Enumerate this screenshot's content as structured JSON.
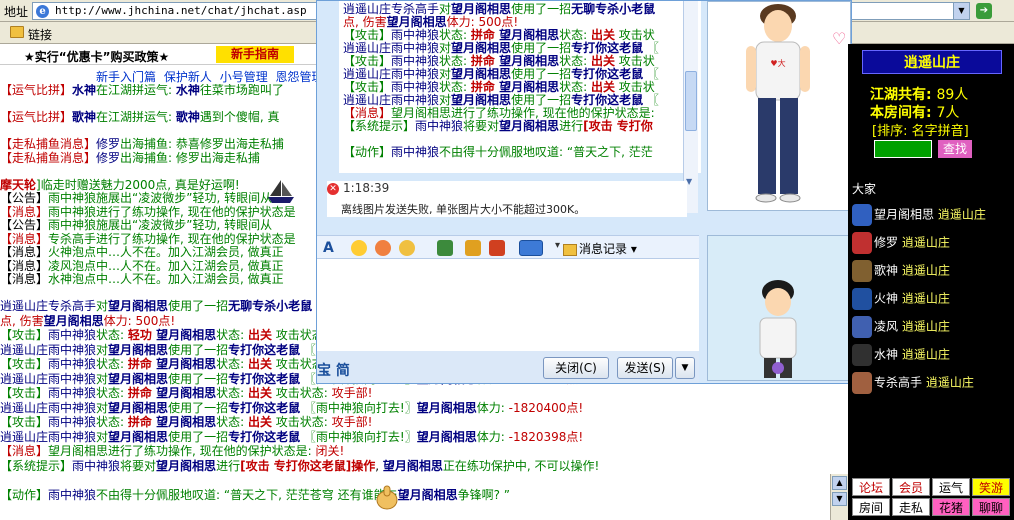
{
  "browser": {
    "address_label": "地址",
    "url": "http://www.jhchina.net/chat/jhchat.asp",
    "links_label": "链接"
  },
  "notice": {
    "text": "★实行“优惠卡”购买政策★",
    "newbie_btn": "新手指南"
  },
  "nav": [
    "新手入门篇",
    "保护新人",
    "小号管理",
    "恩怨管理"
  ],
  "left_lines": [
    [
      {
        "t": "【运气比拼】",
        "c": "r"
      },
      {
        "t": "水神",
        "c": "b bb"
      },
      {
        "t": "在江湖拼运气: ",
        "c": "g"
      },
      {
        "t": "水神",
        "c": "b bb"
      },
      {
        "t": "往菜市场跑叫了",
        "c": "g"
      }
    ],
    [
      {
        "t": "",
        "c": "k"
      }
    ],
    [
      {
        "t": "【运气比拼】",
        "c": "r"
      },
      {
        "t": "歌神",
        "c": "b bb"
      },
      {
        "t": "在江湖拼运气: ",
        "c": "g"
      },
      {
        "t": "歌神",
        "c": "b bb"
      },
      {
        "t": "遇到个傻帽, 真",
        "c": "g"
      }
    ],
    [
      {
        "t": "",
        "c": "k"
      }
    ],
    [
      {
        "t": "【走私捕鱼消息】",
        "c": "r"
      },
      {
        "t": "修罗",
        "c": "b"
      },
      {
        "t": "出海捕鱼: 恭喜修罗出海走私捕",
        "c": "g"
      }
    ],
    [
      {
        "t": "【走私捕鱼消息】",
        "c": "r"
      },
      {
        "t": "修罗",
        "c": "b"
      },
      {
        "t": "出海捕鱼: 修罗出海走私捕",
        "c": "g"
      }
    ],
    [
      {
        "t": "",
        "c": "k"
      }
    ],
    [
      {
        "t": "摩天轮",
        "c": "r bb"
      },
      {
        "t": "]临走时赠送魅力2000点, 真是好运啊!",
        "c": "g"
      }
    ],
    [
      {
        "t": "【公告】",
        "c": "k"
      },
      {
        "t": "雨中神狼施展出“凌波微步”轻功, 转眼间从",
        "c": "g"
      }
    ],
    [
      {
        "t": "【消息】",
        "c": "r"
      },
      {
        "t": "雨中神狼进行了练功操作, 现在他的保护状态是",
        "c": "g"
      }
    ],
    [
      {
        "t": "【公告】",
        "c": "k"
      },
      {
        "t": "雨中神狼施展出“凌波微步”轻功, 转眼间从",
        "c": "g"
      }
    ],
    [
      {
        "t": "【消息】",
        "c": "r"
      },
      {
        "t": "专杀高手进行了练功操作, 现在他的保护状态是",
        "c": "g"
      }
    ],
    [
      {
        "t": "【消息】",
        "c": "k"
      },
      {
        "t": "火神泡点中…人不在。加入江湖会员, 做真正",
        "c": "g"
      }
    ],
    [
      {
        "t": "【消息】",
        "c": "k"
      },
      {
        "t": "凌风泡点中…人不在。加入江湖会员, 做真正",
        "c": "g"
      }
    ],
    [
      {
        "t": "【消息】",
        "c": "k"
      },
      {
        "t": "水神泡点中…人不在。加入江湖会员, 做真正",
        "c": "g"
      }
    ]
  ],
  "lower_lines": [
    [
      {
        "t": "逍遥山庄",
        "c": "b"
      },
      {
        "t": "专杀高手",
        "c": "b"
      },
      {
        "t": "对",
        "c": "g"
      },
      {
        "t": "望月阁相思",
        "c": "b bb"
      },
      {
        "t": "使用了一招",
        "c": "g"
      },
      {
        "t": "无聊专杀小老鼠",
        "c": "b bb"
      }
    ],
    [
      {
        "t": "点, 伤害",
        "c": "r"
      },
      {
        "t": "望月阁相思",
        "c": "b bb"
      },
      {
        "t": "体力: ",
        "c": "r"
      },
      {
        "t": "500点!",
        "c": "r"
      }
    ],
    [
      {
        "t": "【攻击】",
        "c": "g"
      },
      {
        "t": "雨中神狼",
        "c": "b"
      },
      {
        "t": "状态: ",
        "c": "g"
      },
      {
        "t": "轻功",
        "c": "r bb"
      },
      {
        "t": "  望月阁相思",
        "c": "b bb"
      },
      {
        "t": "状态: ",
        "c": "g"
      },
      {
        "t": "出关",
        "c": "r bb"
      },
      {
        "t": "  攻击状态: ",
        "c": "g"
      },
      {
        "t": "攻手部!",
        "c": "r"
      }
    ],
    [
      {
        "t": "逍遥山庄",
        "c": "b"
      },
      {
        "t": "雨中神狼",
        "c": "b"
      },
      {
        "t": "对",
        "c": "g"
      },
      {
        "t": "望月阁相思",
        "c": "b bb"
      },
      {
        "t": "使用了一招",
        "c": "g"
      },
      {
        "t": "专打你这老鼠",
        "c": "b bb"
      },
      {
        "t": "  〖雨中神狼向打去!〗",
        "c": "g"
      },
      {
        "t": "望月阁相思",
        "c": "b bb"
      },
      {
        "t": "体力: ",
        "c": "g"
      },
      {
        "t": "-1820400点!",
        "c": "r"
      }
    ],
    [
      {
        "t": "【攻击】",
        "c": "g"
      },
      {
        "t": "雨中神狼",
        "c": "b"
      },
      {
        "t": "状态: ",
        "c": "g"
      },
      {
        "t": "拼命",
        "c": "r bb"
      },
      {
        "t": "  望月阁相思",
        "c": "b bb"
      },
      {
        "t": "状态: ",
        "c": "g"
      },
      {
        "t": "出关",
        "c": "r bb"
      },
      {
        "t": "  攻击状态: ",
        "c": "g"
      },
      {
        "t": "攻手部!",
        "c": "r"
      }
    ],
    [
      {
        "t": "逍遥山庄",
        "c": "b"
      },
      {
        "t": "雨中神狼",
        "c": "b"
      },
      {
        "t": "对",
        "c": "g"
      },
      {
        "t": "望月阁相思",
        "c": "b bb"
      },
      {
        "t": "使用了一招",
        "c": "g"
      },
      {
        "t": "专打你这老鼠",
        "c": "b bb"
      },
      {
        "t": "  〖雨中神狼向打去!〗",
        "c": "g"
      },
      {
        "t": "望月阁相思",
        "c": "b bb"
      },
      {
        "t": "体力: ",
        "c": "g"
      },
      {
        "t": "-1820400点!",
        "c": "r"
      }
    ],
    [
      {
        "t": "【攻击】",
        "c": "g"
      },
      {
        "t": "雨中神狼",
        "c": "b"
      },
      {
        "t": "状态: ",
        "c": "g"
      },
      {
        "t": "拼命",
        "c": "r bb"
      },
      {
        "t": "  望月阁相思",
        "c": "b bb"
      },
      {
        "t": "状态: ",
        "c": "g"
      },
      {
        "t": "出关",
        "c": "r bb"
      },
      {
        "t": "  攻击状态: ",
        "c": "g"
      },
      {
        "t": "攻手部!",
        "c": "r"
      }
    ],
    [
      {
        "t": "逍遥山庄",
        "c": "b"
      },
      {
        "t": "雨中神狼",
        "c": "b"
      },
      {
        "t": "对",
        "c": "g"
      },
      {
        "t": "望月阁相思",
        "c": "b bb"
      },
      {
        "t": "使用了一招",
        "c": "g"
      },
      {
        "t": "专打你这老鼠",
        "c": "b bb"
      },
      {
        "t": "  〖雨中神狼向打去!〗",
        "c": "g"
      },
      {
        "t": "望月阁相思",
        "c": "b bb"
      },
      {
        "t": "体力: ",
        "c": "g"
      },
      {
        "t": "-1820400点!",
        "c": "r"
      }
    ],
    [
      {
        "t": "【攻击】",
        "c": "g"
      },
      {
        "t": "雨中神狼",
        "c": "b"
      },
      {
        "t": "状态: ",
        "c": "g"
      },
      {
        "t": "拼命",
        "c": "r bb"
      },
      {
        "t": "  望月阁相思",
        "c": "b bb"
      },
      {
        "t": "状态: ",
        "c": "g"
      },
      {
        "t": "出关",
        "c": "r bb"
      },
      {
        "t": "  攻击状态: ",
        "c": "g"
      },
      {
        "t": "攻手部!",
        "c": "r"
      }
    ],
    [
      {
        "t": "逍遥山庄",
        "c": "b"
      },
      {
        "t": "雨中神狼",
        "c": "b"
      },
      {
        "t": "对",
        "c": "g"
      },
      {
        "t": "望月阁相思",
        "c": "b bb"
      },
      {
        "t": "使用了一招",
        "c": "g"
      },
      {
        "t": "专打你这老鼠",
        "c": "b bb"
      },
      {
        "t": "  〖雨中神狼向打去!〗",
        "c": "g"
      },
      {
        "t": "望月阁相思",
        "c": "b bb"
      },
      {
        "t": "体力: ",
        "c": "g"
      },
      {
        "t": "-1820398点!",
        "c": "r"
      }
    ],
    [
      {
        "t": "【消息】",
        "c": "r"
      },
      {
        "t": "望月阁相思进行了练功操作, 现在他的保护状态是: ",
        "c": "g"
      },
      {
        "t": "闭关!",
        "c": "r"
      }
    ],
    [
      {
        "t": "【系统提示】",
        "c": "g"
      },
      {
        "t": "雨中神狼",
        "c": "b"
      },
      {
        "t": "将要对",
        "c": "g"
      },
      {
        "t": "望月阁相思",
        "c": "b bb"
      },
      {
        "t": "进行",
        "c": "g"
      },
      {
        "t": "[攻击  专打你这老鼠]操作",
        "c": "r bb"
      },
      {
        "t": ", ",
        "c": "k"
      },
      {
        "t": "望月阁相思",
        "c": "b bb"
      },
      {
        "t": "正在练功保护中, 不可以操作!",
        "c": "g"
      }
    ],
    [
      {
        "t": "",
        "c": "k"
      }
    ],
    [
      {
        "t": "【动作】",
        "c": "g"
      },
      {
        "t": "雨中神狼",
        "c": "b"
      },
      {
        "t": "不由得十分佩服地叹道: “普天之下, 茫茫苍穹",
        "c": "g"
      },
      {
        "t": "     还有谁能与",
        "c": "g"
      },
      {
        "t": "望月阁相思",
        "c": "b bb"
      },
      {
        "t": "争锋啊? ”",
        "c": "g"
      }
    ]
  ],
  "qq_history": [
    [
      {
        "t": "逍遥山庄",
        "c": "b"
      },
      {
        "t": "专杀高手",
        "c": "b"
      },
      {
        "t": "对",
        "c": "g"
      },
      {
        "t": "望月阁相思",
        "c": "b bb"
      },
      {
        "t": "使用了一招",
        "c": "g"
      },
      {
        "t": "无聊专杀小老鼠",
        "c": "b bb"
      }
    ],
    [
      {
        "t": "点, 伤害",
        "c": "r"
      },
      {
        "t": "望月阁相思",
        "c": "b bb"
      },
      {
        "t": "体力: ",
        "c": "r"
      },
      {
        "t": "500点!",
        "c": "r"
      }
    ],
    [
      {
        "t": "【攻击】",
        "c": "g"
      },
      {
        "t": "雨中神狼",
        "c": "b"
      },
      {
        "t": "状态: ",
        "c": "g"
      },
      {
        "t": "拼命",
        "c": "r bb"
      },
      {
        "t": "  望月阁相思",
        "c": "b bb"
      },
      {
        "t": "状态: ",
        "c": "g"
      },
      {
        "t": "出关",
        "c": "r bb"
      },
      {
        "t": "  攻击状",
        "c": "g"
      }
    ],
    [
      {
        "t": "逍遥山庄",
        "c": "b"
      },
      {
        "t": "雨中神狼",
        "c": "b"
      },
      {
        "t": "对",
        "c": "g"
      },
      {
        "t": "望月阁相思",
        "c": "b bb"
      },
      {
        "t": "使用了一招",
        "c": "g"
      },
      {
        "t": "专打你这老鼠",
        "c": "b bb"
      },
      {
        "t": "  〖",
        "c": "g"
      }
    ],
    [
      {
        "t": "【攻击】",
        "c": "g"
      },
      {
        "t": "雨中神狼",
        "c": "b"
      },
      {
        "t": "状态: ",
        "c": "g"
      },
      {
        "t": "拼命",
        "c": "r bb"
      },
      {
        "t": "  望月阁相思",
        "c": "b bb"
      },
      {
        "t": "状态: ",
        "c": "g"
      },
      {
        "t": "出关",
        "c": "r bb"
      },
      {
        "t": "  攻击状",
        "c": "g"
      }
    ],
    [
      {
        "t": "逍遥山庄",
        "c": "b"
      },
      {
        "t": "雨中神狼",
        "c": "b"
      },
      {
        "t": "对",
        "c": "g"
      },
      {
        "t": "望月阁相思",
        "c": "b bb"
      },
      {
        "t": "使用了一招",
        "c": "g"
      },
      {
        "t": "专打你这老鼠",
        "c": "b bb"
      },
      {
        "t": "  〖",
        "c": "g"
      }
    ],
    [
      {
        "t": "【攻击】",
        "c": "g"
      },
      {
        "t": "雨中神狼",
        "c": "b"
      },
      {
        "t": "状态: ",
        "c": "g"
      },
      {
        "t": "拼命",
        "c": "r bb"
      },
      {
        "t": "  望月阁相思",
        "c": "b bb"
      },
      {
        "t": "状态: ",
        "c": "g"
      },
      {
        "t": "出关",
        "c": "r bb"
      },
      {
        "t": "  攻击状",
        "c": "g"
      }
    ],
    [
      {
        "t": "逍遥山庄",
        "c": "b"
      },
      {
        "t": "雨中神狼",
        "c": "b"
      },
      {
        "t": "对",
        "c": "g"
      },
      {
        "t": "望月阁相思",
        "c": "b bb"
      },
      {
        "t": "使用了一招",
        "c": "g"
      },
      {
        "t": "专打你这老鼠",
        "c": "b bb"
      },
      {
        "t": "  〖",
        "c": "g"
      }
    ],
    [
      {
        "t": "【消息】",
        "c": "r"
      },
      {
        "t": "望月阁相思进行了练功操作, 现在他的保护状态是: ",
        "c": "g"
      }
    ],
    [
      {
        "t": "【系统提示】",
        "c": "g"
      },
      {
        "t": "雨中神狼",
        "c": "b"
      },
      {
        "t": "将要对",
        "c": "g"
      },
      {
        "t": "望月阁相思",
        "c": "b bb"
      },
      {
        "t": "进行",
        "c": "g"
      },
      {
        "t": "[攻击  专打你",
        "c": "r bb"
      }
    ],
    [
      {
        "t": "",
        "c": "k"
      }
    ],
    [
      {
        "t": "【动作】",
        "c": "g"
      },
      {
        "t": "雨中神狼",
        "c": "b"
      },
      {
        "t": "不由得十分佩服地叹道: “普天之下, 茫茫",
        "c": "g"
      }
    ]
  ],
  "qq": {
    "err_time": "1:18:39",
    "err_msg": "离线图片发送失败, 单张图片大小不能超过300K。",
    "history_btn": "消息记录",
    "jian": "宝 简",
    "close_btn": "关闭(C)",
    "send_btn": "发送(S)"
  },
  "room": {
    "title": "逍遥山庄",
    "total_label": "江湖共有: ",
    "total": "89人",
    "room_label": "本房间有: ",
    "room_count": "7人",
    "sort": "[排序: 名字拼音]",
    "find": "查找",
    "dajia": "大家"
  },
  "users": [
    {
      "name": "望月阁相思",
      "loc": "逍遥山庄",
      "color": "#3060c0"
    },
    {
      "name": "修罗",
      "loc": "逍遥山庄",
      "color": "#c03030"
    },
    {
      "name": "歌神",
      "loc": "逍遥山庄",
      "color": "#806030"
    },
    {
      "name": "火神",
      "loc": "逍遥山庄",
      "color": "#2050a0"
    },
    {
      "name": "凌风",
      "loc": "逍遥山庄",
      "color": "#4060b0"
    },
    {
      "name": "水神",
      "loc": "逍遥山庄",
      "color": "#303030"
    },
    {
      "name": "专杀高手",
      "loc": "逍遥山庄",
      "color": "#a06040"
    }
  ],
  "menu": [
    [
      "论坛",
      "会员",
      "运气",
      "笑游"
    ],
    [
      "房间",
      "走私",
      "花猪",
      "聊聊"
    ]
  ]
}
